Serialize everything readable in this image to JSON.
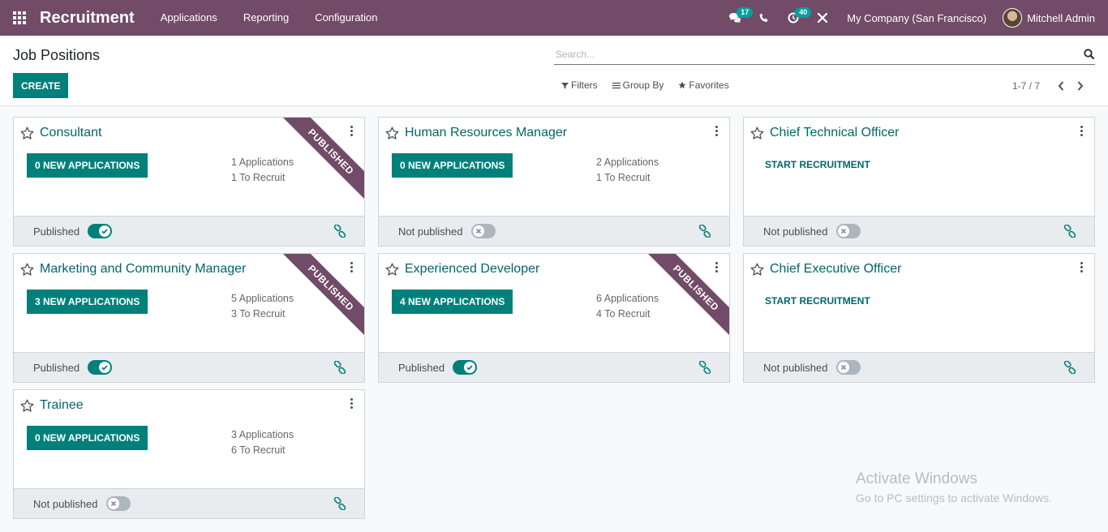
{
  "navbar": {
    "brand": "Recruitment",
    "menu": [
      "Applications",
      "Reporting",
      "Configuration"
    ],
    "messages_count": "17",
    "activities_count": "40",
    "company": "My Company (San Francisco)",
    "user": "Mitchell Admin"
  },
  "control": {
    "title": "Job Positions",
    "create_label": "CREATE",
    "search_placeholder": "Search...",
    "filters_label": "Filters",
    "groupby_label": "Group By",
    "favorites_label": "Favorites",
    "pager": "1-7 / 7"
  },
  "cards": [
    {
      "name": "Consultant",
      "button": "0 NEW APPLICATIONS",
      "applications": "1 Applications",
      "to_recruit": "1 To Recruit",
      "ribbon": "PUBLISHED",
      "status": "Published",
      "published": true
    },
    {
      "name": "Human Resources Manager",
      "button": "0 NEW APPLICATIONS",
      "applications": "2 Applications",
      "to_recruit": "1 To Recruit",
      "ribbon": "",
      "status": "Not published",
      "published": false
    },
    {
      "name": "Chief Technical Officer",
      "link": "START RECRUITMENT",
      "ribbon": "",
      "status": "Not published",
      "published": false
    },
    {
      "name": "Marketing and Community Manager",
      "button": "3 NEW APPLICATIONS",
      "applications": "5 Applications",
      "to_recruit": "3 To Recruit",
      "ribbon": "PUBLISHED",
      "status": "Published",
      "published": true
    },
    {
      "name": "Experienced Developer",
      "button": "4 NEW APPLICATIONS",
      "applications": "6 Applications",
      "to_recruit": "4 To Recruit",
      "ribbon": "PUBLISHED",
      "status": "Published",
      "published": true
    },
    {
      "name": "Chief Executive Officer",
      "link": "START RECRUITMENT",
      "ribbon": "",
      "status": "Not published",
      "published": false
    },
    {
      "name": "Trainee",
      "button": "0 NEW APPLICATIONS",
      "applications": "3 Applications",
      "to_recruit": "6 To Recruit",
      "ribbon": "",
      "status": "Not published",
      "published": false
    }
  ],
  "watermark": {
    "line1": "Activate Windows",
    "line2": "Go to PC settings to activate Windows."
  },
  "colors": {
    "navbar": "#714b67",
    "primary": "#00807a",
    "title_link": "#01666b"
  }
}
